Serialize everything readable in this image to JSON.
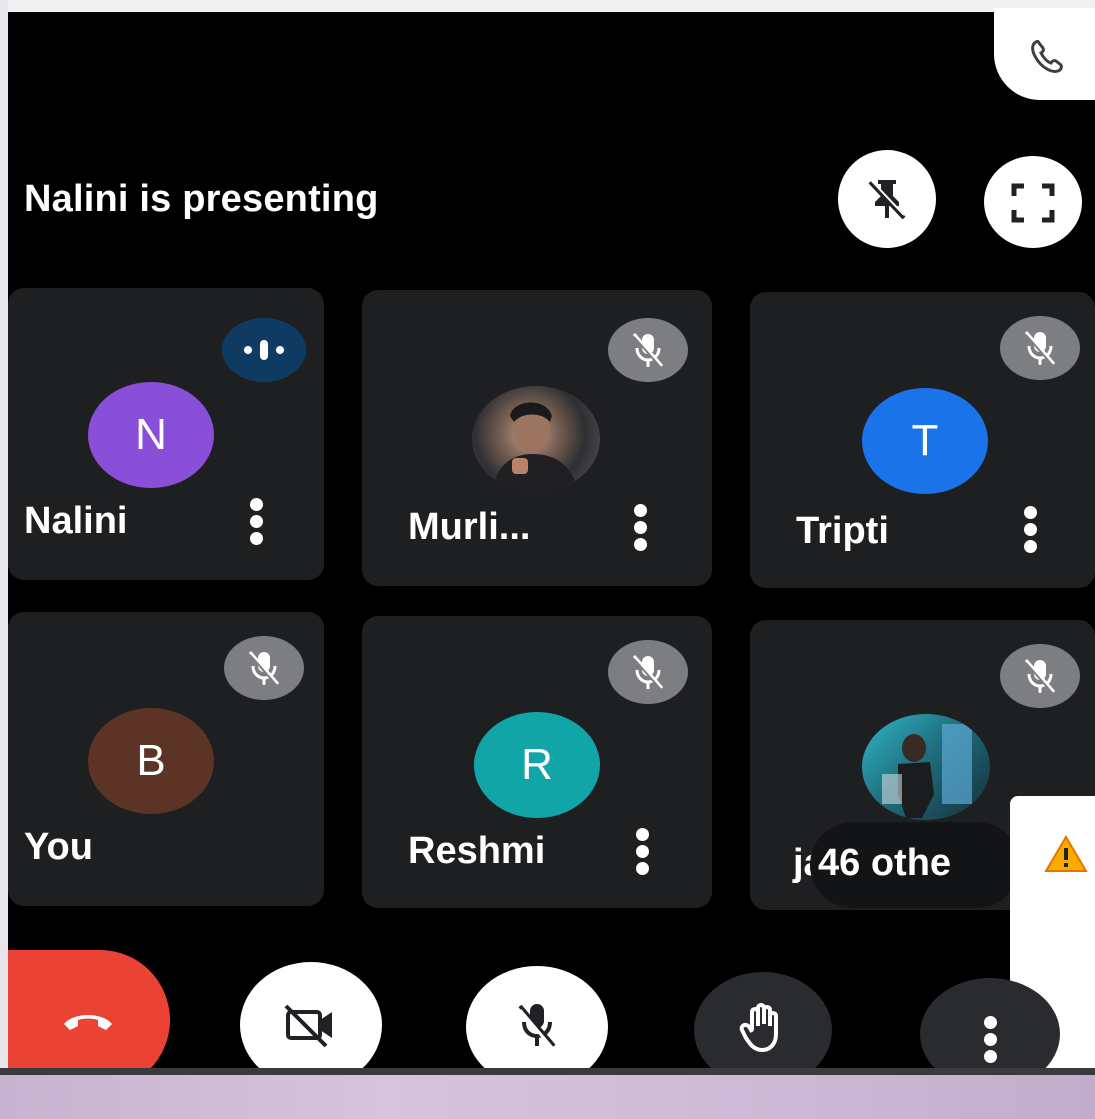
{
  "header": {
    "presenting_text": "Nalini is presenting"
  },
  "participants": [
    {
      "name": "Nalini",
      "initial": "N",
      "color": "#8a4fd8",
      "status": "speaking"
    },
    {
      "name": "Murli...",
      "initial": "",
      "status": "muted",
      "avatar": "photo"
    },
    {
      "name": "Tripti",
      "initial": "T",
      "color": "#1a73e8",
      "status": "muted"
    },
    {
      "name": "You",
      "initial": "B",
      "color": "#5b3425",
      "status": "muted"
    },
    {
      "name": "Reshmi",
      "initial": "R",
      "color": "#12a5a8",
      "status": "muted"
    },
    {
      "name": "ja",
      "initial": "",
      "status": "muted",
      "avatar": "photo"
    }
  ],
  "others": {
    "label": "46 othe"
  },
  "controls": {
    "leave": "end-call-icon",
    "camera": "camera-off-icon",
    "mic": "mic-off-icon",
    "hand": "raise-hand-icon",
    "more": "more-vert-icon"
  },
  "colors": {
    "end_call": "#ea4335",
    "tile": "#1e1f21",
    "muted_badge": "#7c7e81",
    "speaking_badge": "#0f3b63"
  }
}
